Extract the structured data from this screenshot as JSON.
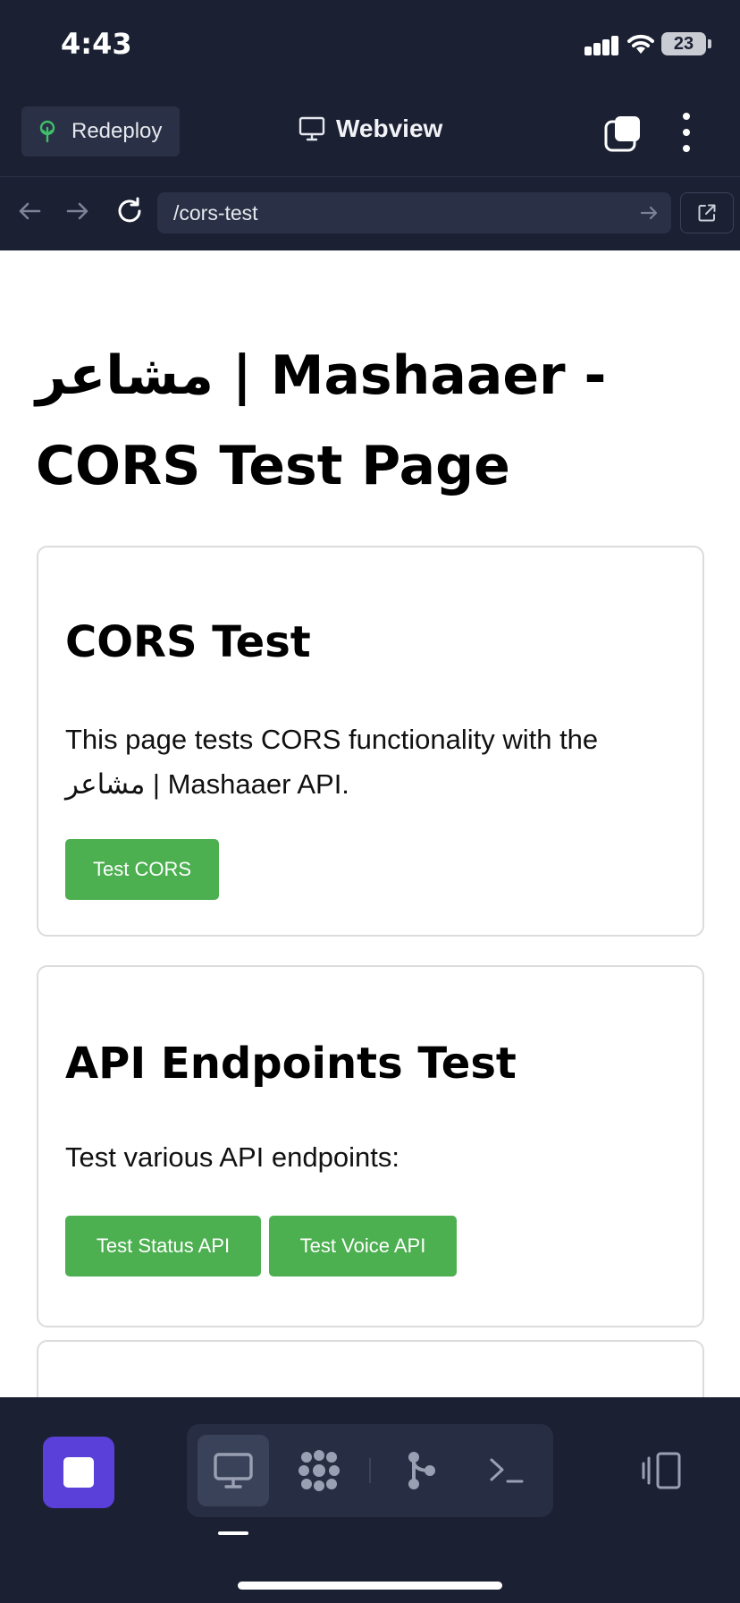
{
  "status_bar": {
    "time": "4:43",
    "battery": "23"
  },
  "header": {
    "redeploy_label": "Redeploy",
    "title": "Webview",
    "icons": [
      "rocket-icon",
      "monitor-icon",
      "tabs-icon",
      "more-icon"
    ]
  },
  "url_bar": {
    "url": "/cors-test"
  },
  "page": {
    "heading": "مشاعر | Mashaaer - CORS Test Page",
    "cards": [
      {
        "title": "CORS Test",
        "text": "This page tests CORS functionality with the مشاعر | Mashaaer API.",
        "buttons": [
          "Test CORS"
        ]
      },
      {
        "title": "API Endpoints Test",
        "text": "Test various API endpoints:",
        "buttons": [
          "Test Status API",
          "Test Voice API"
        ]
      }
    ]
  },
  "bottom_bar": {
    "tools": [
      "webview",
      "tools",
      "git",
      "shell"
    ],
    "active_tool": "webview"
  },
  "colors": {
    "app_bg": "#1b2033",
    "accent": "#5b3fd9",
    "button_green": "#4caf50"
  }
}
